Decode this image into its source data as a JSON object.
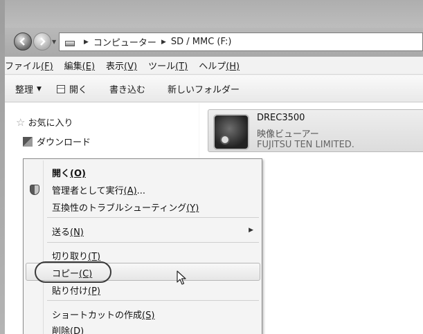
{
  "address_bar": {
    "crumbs": [
      "コンピューター",
      "SD / MMC (F:)"
    ]
  },
  "menubar": {
    "items": [
      {
        "label": "ファイル",
        "key": "(F)"
      },
      {
        "label": "編集",
        "key": "(E)"
      },
      {
        "label": "表示",
        "key": "(V)"
      },
      {
        "label": "ツール",
        "key": "(T)"
      },
      {
        "label": "ヘルプ",
        "key": "(H)"
      }
    ]
  },
  "toolbar": {
    "organize": "整理",
    "open": "開く",
    "write": "書き込む",
    "new_folder": "新しいフォルダー"
  },
  "nav_pane": {
    "favorites": "お気に入り",
    "downloads": "ダウンロード"
  },
  "file": {
    "name": "DREC3500",
    "type": "映像ビューアー",
    "company": "FUJITSU TEN LIMITED."
  },
  "context_menu": {
    "open": {
      "label": "開く",
      "key": "(O)"
    },
    "run_as_admin": {
      "label": "管理者として実行",
      "key": "(A)",
      "suffix": "..."
    },
    "compat": {
      "label": "互換性のトラブルシューティング",
      "key": "(Y)"
    },
    "send_to": {
      "label": "送る",
      "key": "(N)"
    },
    "cut": {
      "label": "切り取り",
      "key": "(T)"
    },
    "copy": {
      "label": "コピー",
      "key": "(C)"
    },
    "paste": {
      "label": "貼り付け",
      "key": "(P)"
    },
    "create_shortcut": {
      "label": "ショートカットの作成",
      "key": "(S)"
    },
    "delete": {
      "label": "削除",
      "key": "(D)"
    }
  }
}
